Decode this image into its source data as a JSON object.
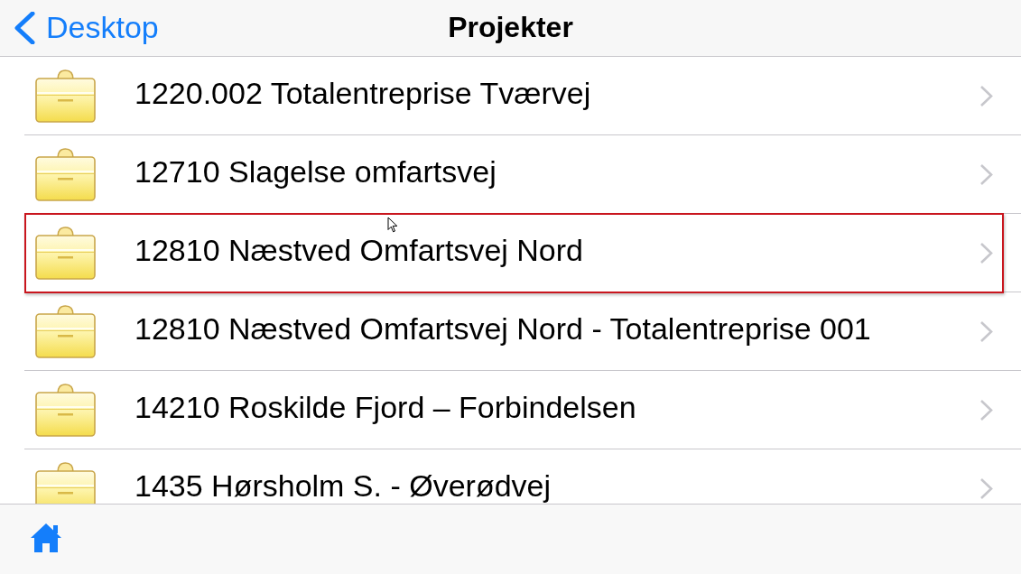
{
  "nav_bar": {
    "back_label": "Desktop",
    "title": "Projekter"
  },
  "projects": [
    {
      "name": "1220.002 Totalentreprise Tværvej",
      "selected": false
    },
    {
      "name": "12710 Slagelse omfartsvej",
      "selected": false
    },
    {
      "name": "12810 Næstved Omfartsvej Nord",
      "selected": true
    },
    {
      "name": "12810 Næstved Omfartsvej Nord - Totalentreprise 001",
      "selected": false
    },
    {
      "name": "14210 Roskilde Fjord – Forbindelsen",
      "selected": false
    },
    {
      "name": "1435 Hørsholm S. - Øverødvej",
      "selected": false
    }
  ]
}
